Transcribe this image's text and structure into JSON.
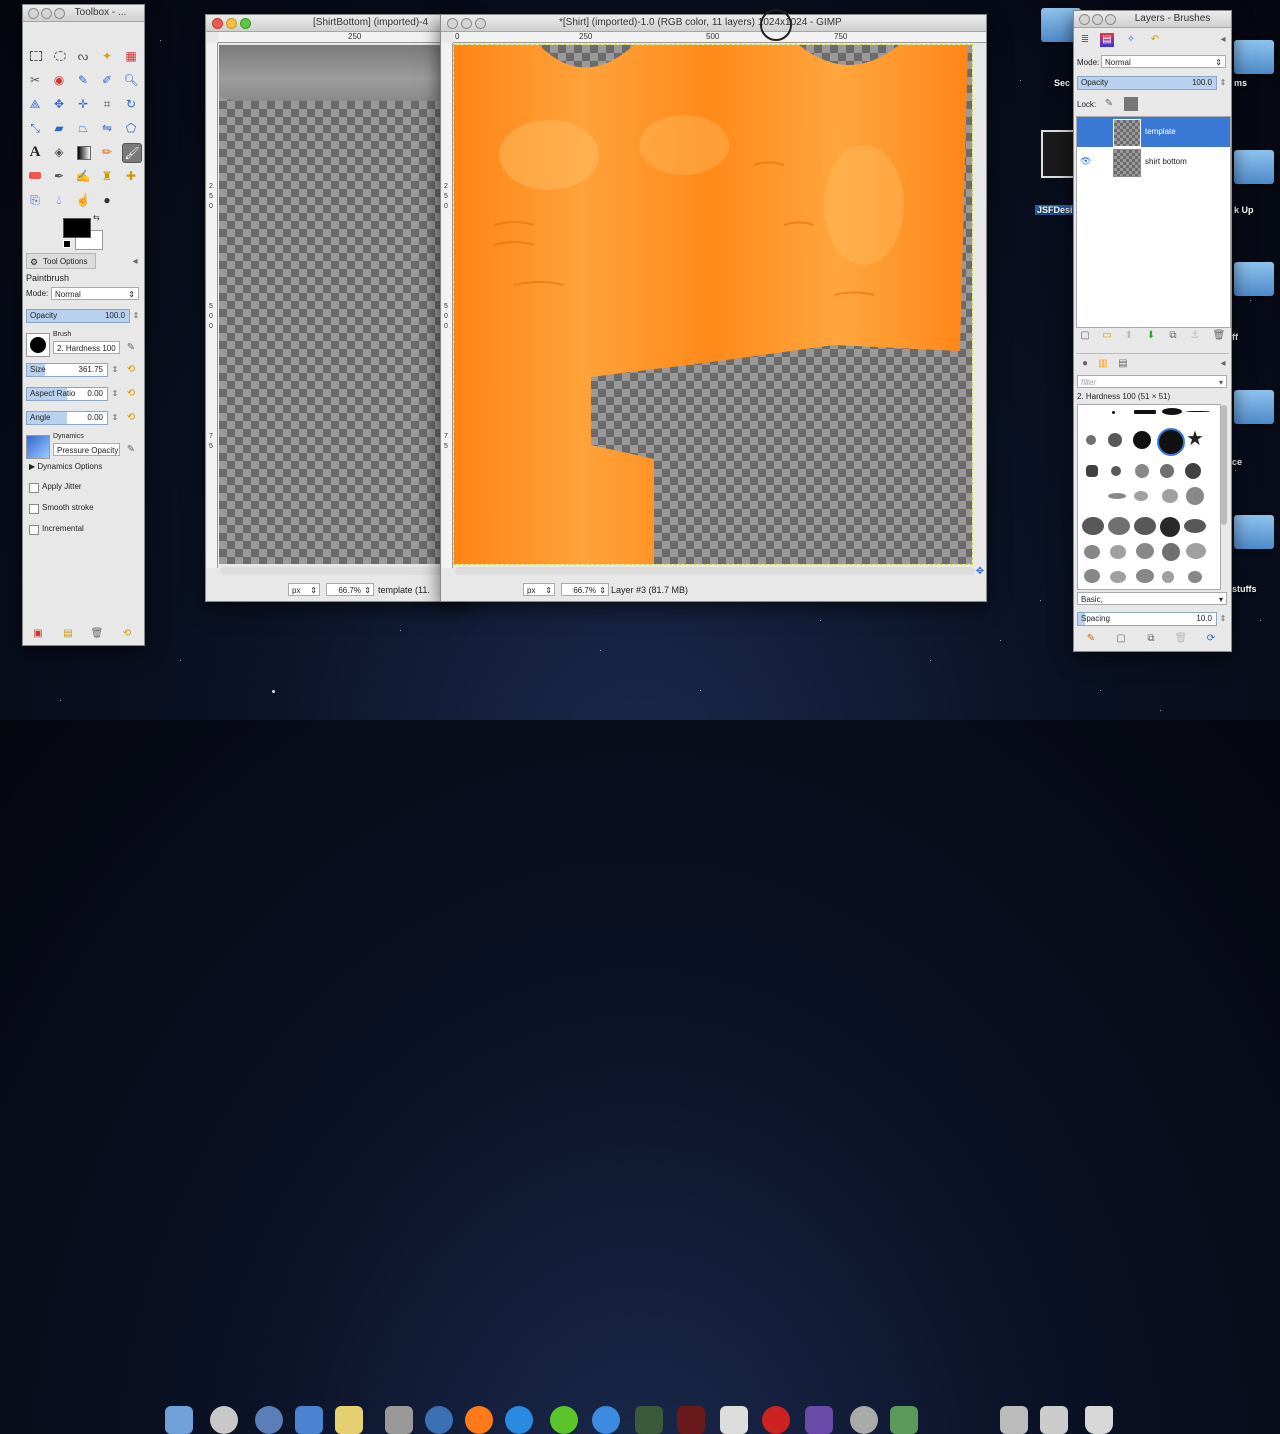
{
  "toolbox": {
    "title": "Toolbox - ...",
    "tool_options_tab": "Tool Options",
    "tool_name": "Paintbrush",
    "mode_label": "Mode:",
    "mode_value": "Normal",
    "opacity_label": "Opacity",
    "opacity_value": "100.0",
    "brush_label": "Brush",
    "brush_value": "2. Hardness 100",
    "size_label": "Size",
    "size_value": "361.75",
    "aspect_label": "Aspect Ratio",
    "aspect_value": "0.00",
    "angle_label": "Angle",
    "angle_value": "0.00",
    "dynamics_label": "Dynamics",
    "dynamics_value": "Pressure Opacity",
    "dynamics_options": "Dynamics Options",
    "apply_jitter": "Apply Jitter",
    "smooth_stroke": "Smooth stroke",
    "incremental": "Incremental"
  },
  "window_bottom": {
    "title": "[ShirtBottom] (imported)-4",
    "ruler_250": "250",
    "unit": "px",
    "zoom": "66.7%",
    "status": "template (11.",
    "vruler": [
      "2",
      "5",
      "0",
      "5",
      "0",
      "0",
      "7",
      "5"
    ]
  },
  "window_shirt": {
    "title": "*[Shirt] (imported)-1.0 (RGB color, 11 layers) 1024x1024 - GIMP",
    "ruler_ticks": [
      "0",
      "250",
      "500",
      "750"
    ],
    "unit": "px",
    "zoom": "66.7%",
    "status": "Layer #3 (81.7 MB)",
    "vruler": [
      "2",
      "5",
      "0",
      "5",
      "0",
      "0",
      "7",
      "5"
    ]
  },
  "layers": {
    "title": "Layers - Brushes",
    "mode_label": "Mode:",
    "mode_value": "Normal",
    "opacity_label": "Opacity",
    "opacity_value": "100.0",
    "lock_label": "Lock:",
    "items": [
      {
        "name": "template",
        "selected": true
      },
      {
        "name": "shirt bottom",
        "selected": false
      }
    ],
    "filter_placeholder": "filter",
    "brush_name": "2. Hardness 100 (51 × 51)",
    "tag_value": "Basic,",
    "spacing_label": "Spacing",
    "spacing_value": "10.0"
  },
  "desktop": {
    "labels": [
      "Sec",
      "ms",
      "JSFDesi",
      "k Up",
      "ff",
      "ce",
      "stuffs"
    ]
  },
  "colors": {
    "orange": "#ff8a1a",
    "selection": "#3a78d6",
    "checker_dark": "#6b6b6b",
    "checker_light": "#9a9a9a"
  }
}
